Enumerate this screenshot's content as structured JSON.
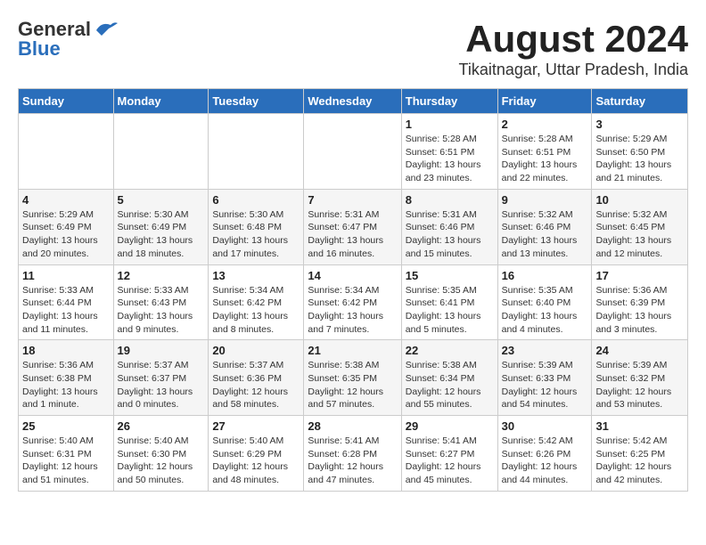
{
  "header": {
    "logo_general": "General",
    "logo_blue": "Blue",
    "title": "August 2024",
    "subtitle": "Tikaitnagar, Uttar Pradesh, India"
  },
  "columns": [
    "Sunday",
    "Monday",
    "Tuesday",
    "Wednesday",
    "Thursday",
    "Friday",
    "Saturday"
  ],
  "weeks": [
    [
      {
        "day": "",
        "info": ""
      },
      {
        "day": "",
        "info": ""
      },
      {
        "day": "",
        "info": ""
      },
      {
        "day": "",
        "info": ""
      },
      {
        "day": "1",
        "info": "Sunrise: 5:28 AM\nSunset: 6:51 PM\nDaylight: 13 hours and 23 minutes."
      },
      {
        "day": "2",
        "info": "Sunrise: 5:28 AM\nSunset: 6:51 PM\nDaylight: 13 hours and 22 minutes."
      },
      {
        "day": "3",
        "info": "Sunrise: 5:29 AM\nSunset: 6:50 PM\nDaylight: 13 hours and 21 minutes."
      }
    ],
    [
      {
        "day": "4",
        "info": "Sunrise: 5:29 AM\nSunset: 6:49 PM\nDaylight: 13 hours and 20 minutes."
      },
      {
        "day": "5",
        "info": "Sunrise: 5:30 AM\nSunset: 6:49 PM\nDaylight: 13 hours and 18 minutes."
      },
      {
        "day": "6",
        "info": "Sunrise: 5:30 AM\nSunset: 6:48 PM\nDaylight: 13 hours and 17 minutes."
      },
      {
        "day": "7",
        "info": "Sunrise: 5:31 AM\nSunset: 6:47 PM\nDaylight: 13 hours and 16 minutes."
      },
      {
        "day": "8",
        "info": "Sunrise: 5:31 AM\nSunset: 6:46 PM\nDaylight: 13 hours and 15 minutes."
      },
      {
        "day": "9",
        "info": "Sunrise: 5:32 AM\nSunset: 6:46 PM\nDaylight: 13 hours and 13 minutes."
      },
      {
        "day": "10",
        "info": "Sunrise: 5:32 AM\nSunset: 6:45 PM\nDaylight: 13 hours and 12 minutes."
      }
    ],
    [
      {
        "day": "11",
        "info": "Sunrise: 5:33 AM\nSunset: 6:44 PM\nDaylight: 13 hours and 11 minutes."
      },
      {
        "day": "12",
        "info": "Sunrise: 5:33 AM\nSunset: 6:43 PM\nDaylight: 13 hours and 9 minutes."
      },
      {
        "day": "13",
        "info": "Sunrise: 5:34 AM\nSunset: 6:42 PM\nDaylight: 13 hours and 8 minutes."
      },
      {
        "day": "14",
        "info": "Sunrise: 5:34 AM\nSunset: 6:42 PM\nDaylight: 13 hours and 7 minutes."
      },
      {
        "day": "15",
        "info": "Sunrise: 5:35 AM\nSunset: 6:41 PM\nDaylight: 13 hours and 5 minutes."
      },
      {
        "day": "16",
        "info": "Sunrise: 5:35 AM\nSunset: 6:40 PM\nDaylight: 13 hours and 4 minutes."
      },
      {
        "day": "17",
        "info": "Sunrise: 5:36 AM\nSunset: 6:39 PM\nDaylight: 13 hours and 3 minutes."
      }
    ],
    [
      {
        "day": "18",
        "info": "Sunrise: 5:36 AM\nSunset: 6:38 PM\nDaylight: 13 hours and 1 minute."
      },
      {
        "day": "19",
        "info": "Sunrise: 5:37 AM\nSunset: 6:37 PM\nDaylight: 13 hours and 0 minutes."
      },
      {
        "day": "20",
        "info": "Sunrise: 5:37 AM\nSunset: 6:36 PM\nDaylight: 12 hours and 58 minutes."
      },
      {
        "day": "21",
        "info": "Sunrise: 5:38 AM\nSunset: 6:35 PM\nDaylight: 12 hours and 57 minutes."
      },
      {
        "day": "22",
        "info": "Sunrise: 5:38 AM\nSunset: 6:34 PM\nDaylight: 12 hours and 55 minutes."
      },
      {
        "day": "23",
        "info": "Sunrise: 5:39 AM\nSunset: 6:33 PM\nDaylight: 12 hours and 54 minutes."
      },
      {
        "day": "24",
        "info": "Sunrise: 5:39 AM\nSunset: 6:32 PM\nDaylight: 12 hours and 53 minutes."
      }
    ],
    [
      {
        "day": "25",
        "info": "Sunrise: 5:40 AM\nSunset: 6:31 PM\nDaylight: 12 hours and 51 minutes."
      },
      {
        "day": "26",
        "info": "Sunrise: 5:40 AM\nSunset: 6:30 PM\nDaylight: 12 hours and 50 minutes."
      },
      {
        "day": "27",
        "info": "Sunrise: 5:40 AM\nSunset: 6:29 PM\nDaylight: 12 hours and 48 minutes."
      },
      {
        "day": "28",
        "info": "Sunrise: 5:41 AM\nSunset: 6:28 PM\nDaylight: 12 hours and 47 minutes."
      },
      {
        "day": "29",
        "info": "Sunrise: 5:41 AM\nSunset: 6:27 PM\nDaylight: 12 hours and 45 minutes."
      },
      {
        "day": "30",
        "info": "Sunrise: 5:42 AM\nSunset: 6:26 PM\nDaylight: 12 hours and 44 minutes."
      },
      {
        "day": "31",
        "info": "Sunrise: 5:42 AM\nSunset: 6:25 PM\nDaylight: 12 hours and 42 minutes."
      }
    ]
  ]
}
